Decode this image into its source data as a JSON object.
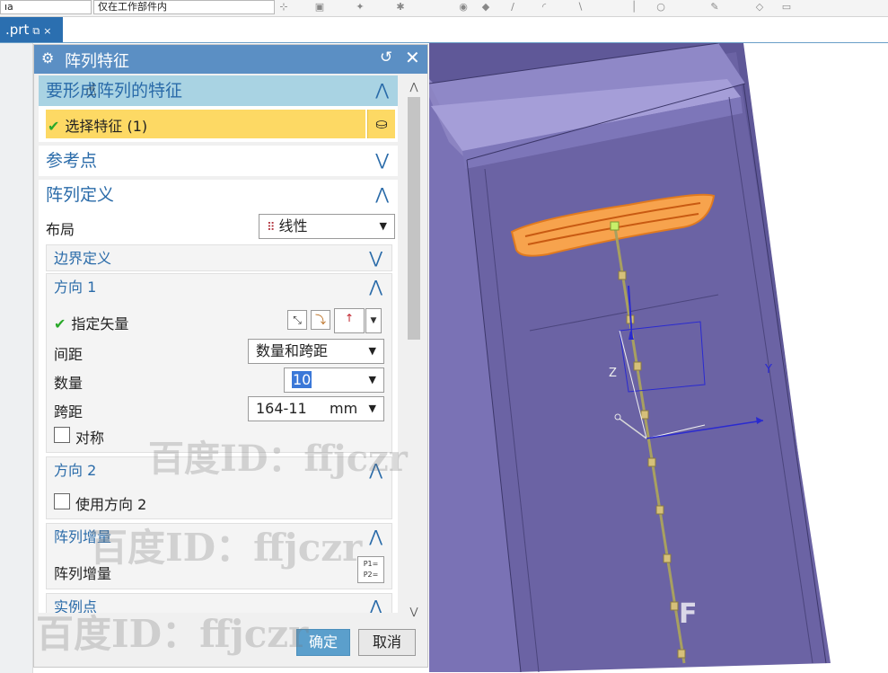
{
  "toolbar": {
    "field1": "ıa",
    "field2": "仅在工作部件内"
  },
  "tab": {
    "label": ".prt",
    "icon": "pin-icon",
    "close": "×"
  },
  "dialog": {
    "title": "阵列特征",
    "features_section": {
      "title": "要形成阵列的特征",
      "select_label": "选择特征 (1)"
    },
    "reference_section": {
      "title": "参考点"
    },
    "definition_section": {
      "title": "阵列定义",
      "layout_label": "布局",
      "layout_value": "线性",
      "boundary": {
        "title": "边界定义"
      },
      "direction1": {
        "title": "方向 1",
        "vector_label": "指定矢量",
        "spacing_label": "间距",
        "spacing_value": "数量和跨距",
        "count_label": "数量",
        "count_value": "10",
        "span_label": "跨距",
        "span_value": "164-11",
        "span_unit": "mm",
        "symmetric_label": "对称"
      },
      "direction2": {
        "title": "方向 2",
        "use_label": "使用方向 2"
      },
      "increment": {
        "title": "阵列增量",
        "label": "阵列增量",
        "icon_text": "P1= P2="
      },
      "instance": {
        "title": "实例点"
      }
    },
    "ok": "确定",
    "cancel": "取消"
  },
  "viewport": {
    "axis_y": "Y",
    "axis_z": "Z"
  },
  "watermark": {
    "text": "百度ID：ffjczr",
    "corner": "F"
  },
  "colors": {
    "accent": "#5b8fc4",
    "section_active": "#a9d3e3",
    "selected_row": "#fdd964",
    "model": "#6c63a3",
    "handle": "#f5a04a"
  }
}
